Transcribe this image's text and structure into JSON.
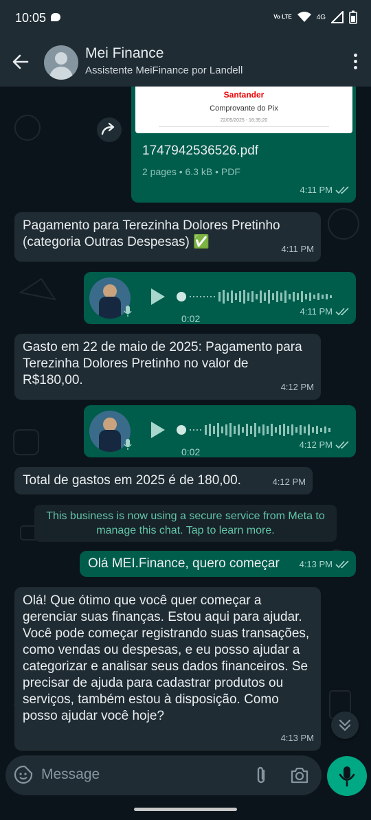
{
  "status_bar": {
    "time": "10:05",
    "network": "4G",
    "volte": "Vo LTE"
  },
  "header": {
    "contact_name": "Mei Finance",
    "subtitle": "Assistente MeiFinance por Landell"
  },
  "messages": {
    "pdf": {
      "preview_brand": "Santander",
      "preview_title": "Comprovante do Pix",
      "preview_date": "22/05/2025 - 16:35:20",
      "file_name": "1747942536526.pdf",
      "file_meta": "2 pages • 6.3 kB • PDF",
      "time": "4:11 PM"
    },
    "msg1": {
      "text": "Pagamento para Terezinha Dolores Pretinho (categoria Outras Despesas) ✅",
      "time": "4:11 PM"
    },
    "voice1": {
      "duration": "0:02",
      "time": "4:11 PM"
    },
    "msg2": {
      "text": "Gasto em 22 de maio de 2025: Pagamento para Terezinha Dolores Pretinho no valor de R$180,00.",
      "time": "4:12 PM"
    },
    "voice2": {
      "duration": "0:02",
      "time": "4:12 PM"
    },
    "msg3": {
      "text": "Total de gastos em 2025 é de 180,00.",
      "time": "4:12 PM"
    },
    "system_note": "This business is now using a secure service from Meta to manage this chat. Tap to learn more.",
    "msg4": {
      "text": "Olá MEI.Finance, quero começar",
      "time": "4:13 PM"
    },
    "msg5": {
      "text": "Olá! Que ótimo que você quer começar a gerenciar suas finanças. Estou aqui para ajudar. Você pode começar registrando suas transações, como vendas ou despesas, e eu posso ajudar a categorizar e analisar seus dados financeiros. Se precisar de ajuda para cadastrar produtos ou serviços, também estou à disposição. Como posso ajudar você hoje?",
      "time": "4:13 PM"
    }
  },
  "composer": {
    "placeholder": "Message"
  },
  "colors": {
    "background": "#0b141a",
    "bar": "#1f2c34",
    "incoming": "#202c33",
    "outgoing": "#005c4b",
    "accent": "#00a884",
    "system_text": "#62c5a7"
  }
}
